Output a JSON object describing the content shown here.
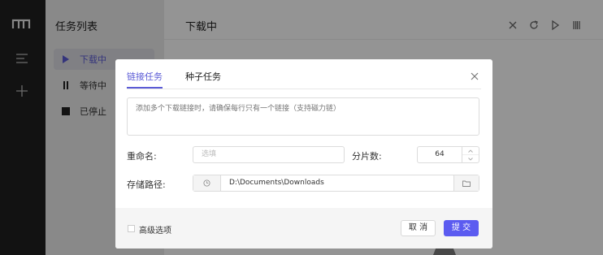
{
  "sidebar": {
    "title": "任务列表",
    "items": [
      {
        "label": "下载中",
        "icon": "play-icon"
      },
      {
        "label": "等待中",
        "icon": "pause-icon"
      },
      {
        "label": "已停止",
        "icon": "stop-icon"
      }
    ]
  },
  "header": {
    "title": "下载中",
    "controls": [
      "close-icon",
      "refresh-icon",
      "play-icon",
      "pause-icon"
    ]
  },
  "dialog": {
    "tabs": [
      "链接任务",
      "种子任务"
    ],
    "active_tab": 0,
    "url_placeholder": "添加多个下载链接时，请确保每行只有一个链接（支持磁力链）",
    "rename_label": "重命名:",
    "rename_placeholder": "选填",
    "split_label": "分片数:",
    "split_value": "64",
    "path_label": "存储路径:",
    "path_value": "D:\\Documents\\Downloads",
    "advanced_label": "高级选项",
    "cancel_label": "取 消",
    "submit_label": "提 交"
  },
  "colors": {
    "accent": "#5b5bd6",
    "submit": "#5b5bf0",
    "rail": "#1f1f1f"
  }
}
